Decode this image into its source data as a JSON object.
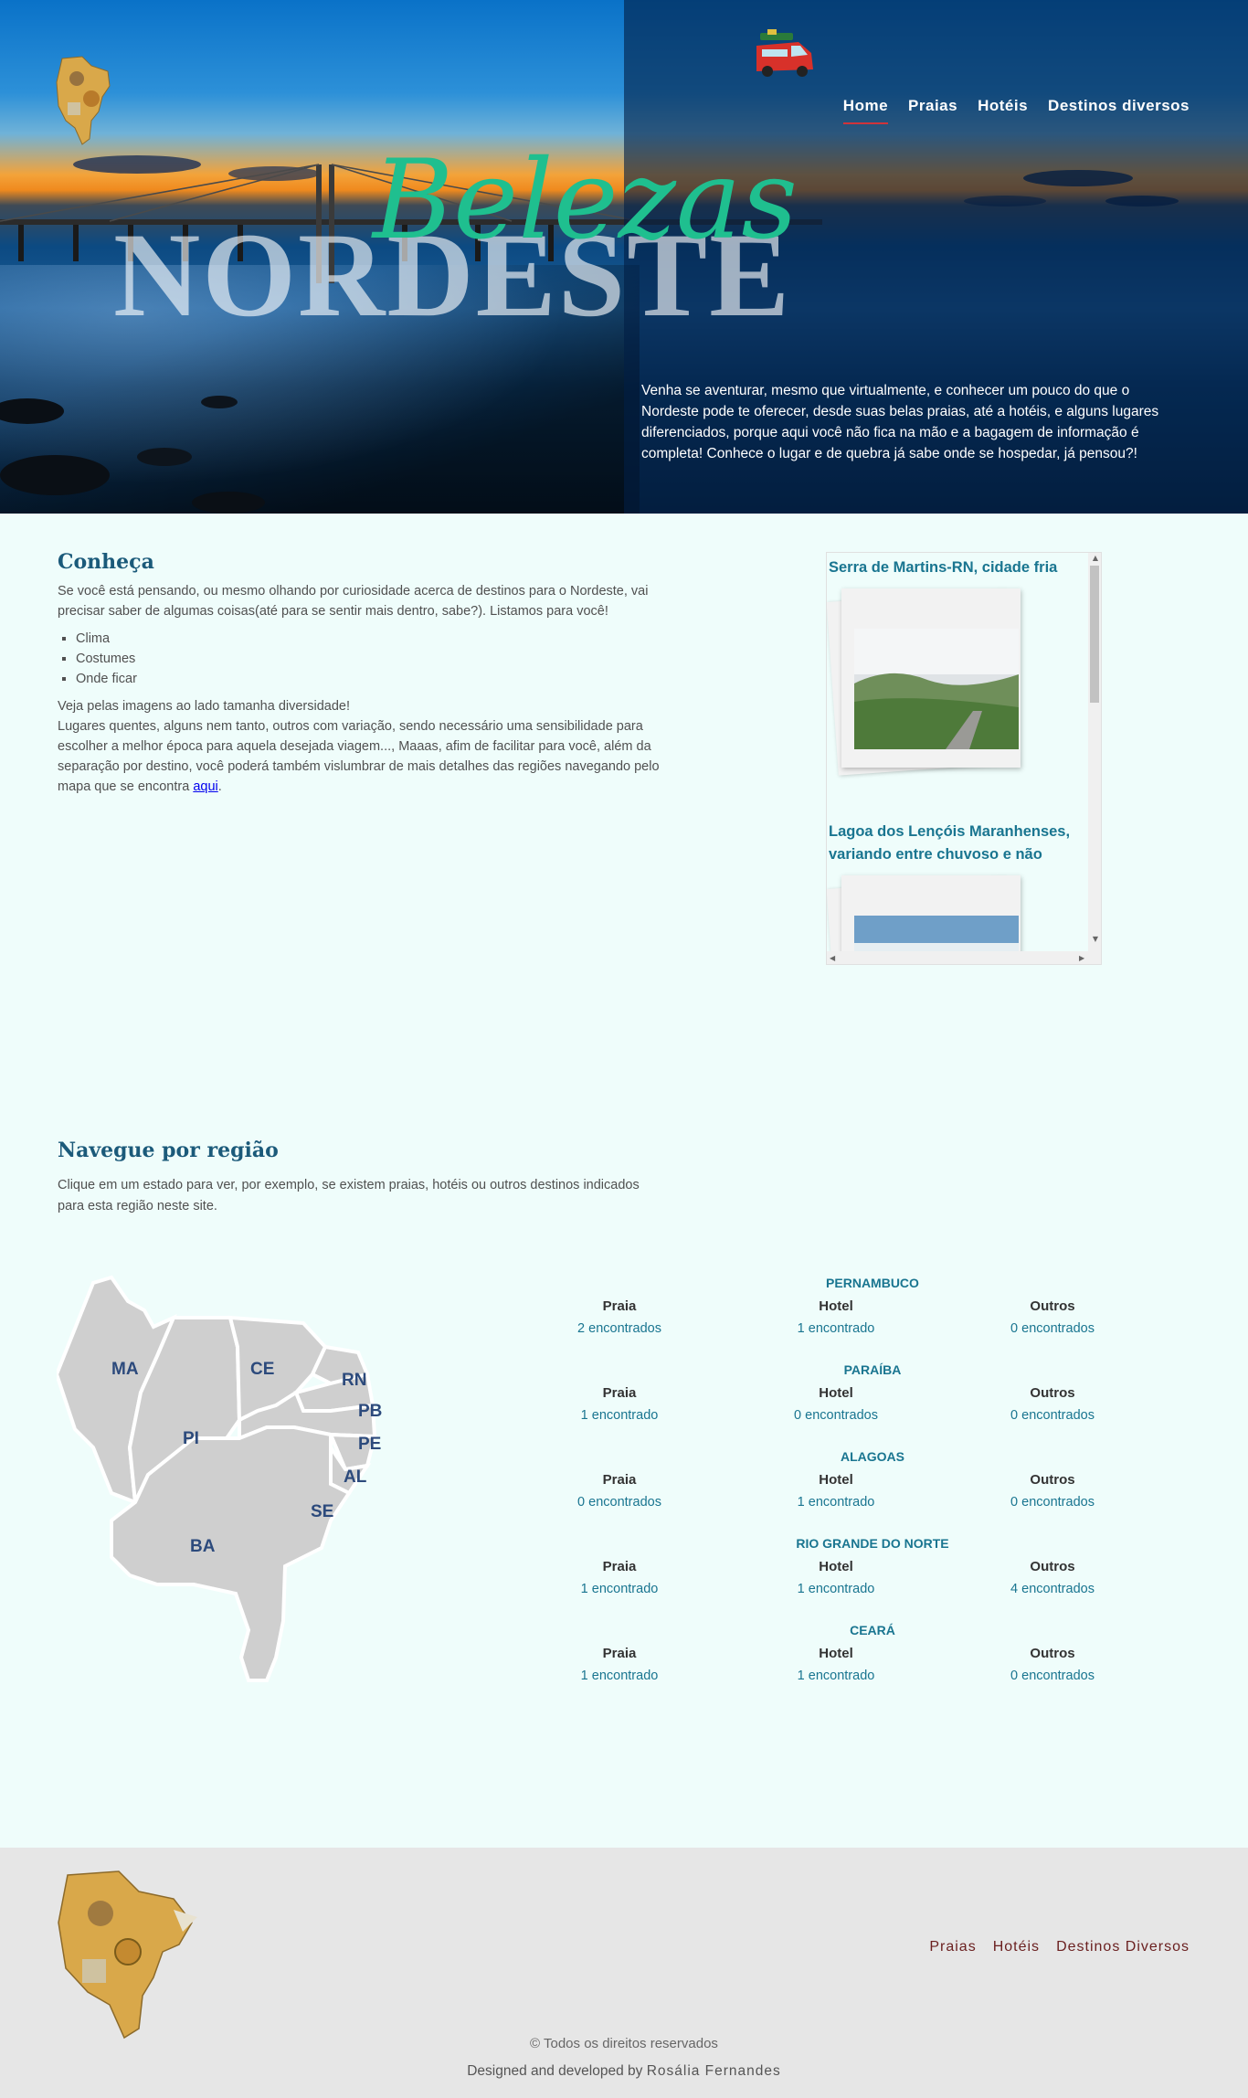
{
  "nav": {
    "items": [
      {
        "label": "Home",
        "active": true
      },
      {
        "label": "Praias",
        "active": false
      },
      {
        "label": "Hotéis",
        "active": false
      },
      {
        "label": "Destinos diversos",
        "active": false
      }
    ]
  },
  "hero": {
    "big_word": "NORDESTE",
    "script_word": "Belezas",
    "intro": "Venha se aventurar, mesmo que virtualmente, e conhecer um pouco do que o Nordeste pode te oferecer, desde suas belas praias, até a hotéis, e alguns lugares diferenciados, porque aqui você não fica na mão e a bagagem de informação é completa! Conhece o lugar e de quebra já sabe onde se hospedar, já pensou?!"
  },
  "conheca": {
    "title": "Conheça",
    "p1": "Se você está pensando, ou mesmo olhando por curiosidade acerca de destinos para o Nordeste, vai precisar saber de algumas coisas(até para se sentir mais dentro, sabe?). Listamos para você!",
    "list": [
      "Clima",
      "Costumes",
      "Onde ficar"
    ],
    "p2_line1": "Veja pelas imagens ao lado tamanha diversidade!",
    "p2_body": "Lugares quentes, alguns nem tanto, outros com variação, sendo necessário uma sensibilidade para escolher a melhor época para aquela desejada viagem..., Maaas, afim de facilitar para você, além da separação por destino, você poderá também vislumbrar de mais detalhes das regiões navegando pelo mapa que se encontra ",
    "link": "aqui",
    "p2_end": "."
  },
  "gallery": {
    "items": [
      {
        "title": "Serra de Martins-RN, cidade fria"
      },
      {
        "title": "Lagoa dos Lençóis Maranhenses, variando entre chuvoso e não"
      }
    ]
  },
  "regiao": {
    "title": "Navegue por região",
    "text": "Clique em um estado para ver, por exemplo, se existem praias, hotéis ou outros destinos indicados para esta região neste site.",
    "map_labels": {
      "ma": "MA",
      "ce": "CE",
      "rn": "RN",
      "pb": "PB",
      "pi": "PI",
      "pe": "PE",
      "al": "AL",
      "se": "SE",
      "ba": "BA"
    }
  },
  "states": [
    {
      "name": "PERNAMBUCO",
      "praia_label": "Praia",
      "praia": "2 encontrados",
      "hotel_label": "Hotel",
      "hotel": "1 encontrado",
      "outros_label": "Outros",
      "outros": "0 encontrados"
    },
    {
      "name": "PARAÍBA",
      "praia_label": "Praia",
      "praia": "1 encontrado",
      "hotel_label": "Hotel",
      "hotel": "0 encontrados",
      "outros_label": "Outros",
      "outros": "0 encontrados"
    },
    {
      "name": "ALAGOAS",
      "praia_label": "Praia",
      "praia": "0 encontrados",
      "hotel_label": "Hotel",
      "hotel": "1 encontrado",
      "outros_label": "Outros",
      "outros": "0 encontrados"
    },
    {
      "name": "RIO GRANDE DO NORTE",
      "praia_label": "Praia",
      "praia": "1 encontrado",
      "hotel_label": "Hotel",
      "hotel": "1 encontrado",
      "outros_label": "Outros",
      "outros": "4 encontrados"
    },
    {
      "name": "CEARÁ",
      "praia_label": "Praia",
      "praia": "1 encontrado",
      "hotel_label": "Hotel",
      "hotel": "1 encontrado",
      "outros_label": "Outros",
      "outros": "0 encontrados"
    }
  ],
  "footer": {
    "nav": [
      "Praias",
      "Hotéis",
      "Destinos Diversos"
    ],
    "copyright": "© Todos os direitos reservados",
    "credits_prefix": "Designed and developed by ",
    "author": "Rosália Fernandes"
  },
  "colors": {
    "accent": "#197590",
    "title": "#1b5a7a",
    "script": "#1fbf8f",
    "background": "#effdfb",
    "footer_bg": "#e6e6e6",
    "nav_active": "#d0343a"
  },
  "icons": [
    "nordeste-map-logo-icon",
    "van-icon",
    "map-of-northeast-icon"
  ]
}
